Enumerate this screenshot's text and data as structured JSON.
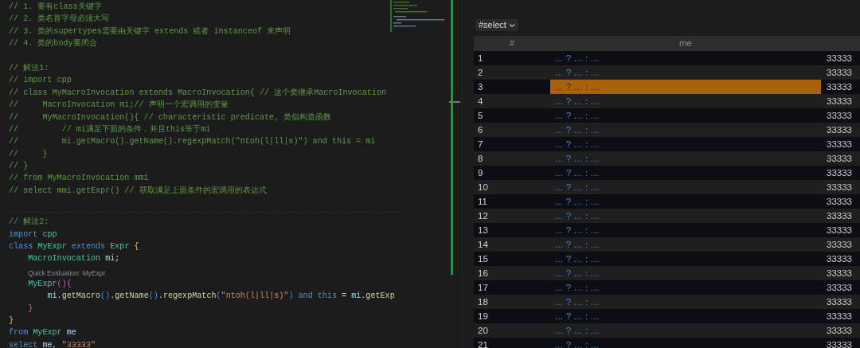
{
  "editor": {
    "lines": [
      {
        "kind": "code",
        "tokens": [
          {
            "text": "// 1. 要有class关键字",
            "kind": "comment"
          }
        ]
      },
      {
        "kind": "code",
        "tokens": [
          {
            "text": "// 2. 类名首字母必须大写",
            "kind": "comment"
          }
        ]
      },
      {
        "kind": "code",
        "tokens": [
          {
            "text": "// 3. 类的supertypes需要由关键字 extends 或者 instanceof 来声明",
            "kind": "comment"
          }
        ]
      },
      {
        "kind": "code",
        "tokens": [
          {
            "text": "// 4. 类的body要闭合",
            "kind": "comment"
          }
        ]
      },
      {
        "kind": "blank"
      },
      {
        "kind": "code",
        "tokens": [
          {
            "text": "// 解法1:",
            "kind": "comment"
          }
        ]
      },
      {
        "kind": "code",
        "tokens": [
          {
            "text": "// import cpp",
            "kind": "comment"
          }
        ]
      },
      {
        "kind": "code",
        "tokens": [
          {
            "text": "// class MyMacroInvocation extends MacroInvocation{ // 这个类继承MacroInvocation",
            "kind": "comment"
          }
        ]
      },
      {
        "kind": "code",
        "tokens": [
          {
            "text": "//     MacroInvocation mi;// 声明一个宏调用的变量",
            "kind": "comment"
          }
        ]
      },
      {
        "kind": "code",
        "tokens": [
          {
            "text": "//     MyMacroInvocation(){ // characteristic predicate, 类似构造函数",
            "kind": "comment"
          }
        ]
      },
      {
        "kind": "code",
        "tokens": [
          {
            "text": "//         // mi满足下面的条件，并且this等于mi",
            "kind": "comment"
          }
        ]
      },
      {
        "kind": "code",
        "tokens": [
          {
            "text": "//         mi.getMacro().getName().regexpMatch(\"ntoh(l|ll|s)\") and this = mi",
            "kind": "comment"
          }
        ]
      },
      {
        "kind": "code",
        "tokens": [
          {
            "text": "//     }",
            "kind": "comment"
          }
        ]
      },
      {
        "kind": "code",
        "tokens": [
          {
            "text": "// }",
            "kind": "comment"
          }
        ]
      },
      {
        "kind": "code",
        "tokens": [
          {
            "text": "// from MyMacroInvocation mmi",
            "kind": "comment"
          }
        ]
      },
      {
        "kind": "code",
        "tokens": [
          {
            "text": "// select mmi.getExpr() // 获取满足上面条件的宏调用的表达式",
            "kind": "comment"
          }
        ]
      },
      {
        "kind": "blank"
      },
      {
        "kind": "code",
        "tokens": [
          {
            "text": "// 解法2:",
            "kind": "comment"
          }
        ]
      },
      {
        "kind": "code",
        "tokens": [
          {
            "text": "import",
            "kind": "keyword"
          },
          {
            "text": " cpp",
            "kind": "type"
          }
        ]
      },
      {
        "kind": "code",
        "tokens": [
          {
            "text": "class",
            "kind": "keyword"
          },
          {
            "text": " MyExpr",
            "kind": "type"
          },
          {
            "text": " extends",
            "kind": "keyword"
          },
          {
            "text": " Expr",
            "kind": "type"
          },
          {
            "text": " {",
            "kind": "brace1"
          }
        ]
      },
      {
        "kind": "code",
        "tokens": [
          {
            "text": "    MacroInvocation",
            "kind": "type"
          },
          {
            "text": " mi",
            "kind": "ident"
          },
          {
            "text": ";",
            "kind": "plain"
          }
        ]
      },
      {
        "kind": "codelens",
        "text": "Quick Evaluation: MyExpr"
      },
      {
        "kind": "code",
        "tokens": [
          {
            "text": "    MyExpr",
            "kind": "type"
          },
          {
            "text": "(){",
            "kind": "brace2"
          }
        ]
      },
      {
        "kind": "code",
        "tokens": [
          {
            "text": "        mi",
            "kind": "ident"
          },
          {
            "text": ".",
            "kind": "plain"
          },
          {
            "text": "getMacro",
            "kind": "func"
          },
          {
            "text": "()",
            "kind": "brace3"
          },
          {
            "text": ".",
            "kind": "plain"
          },
          {
            "text": "getName",
            "kind": "func"
          },
          {
            "text": "()",
            "kind": "brace3"
          },
          {
            "text": ".",
            "kind": "plain"
          },
          {
            "text": "regexpMatch",
            "kind": "func"
          },
          {
            "text": "(",
            "kind": "brace3"
          },
          {
            "text": "\"ntoh(l|ll|s)\"",
            "kind": "string"
          },
          {
            "text": ")",
            "kind": "brace3"
          },
          {
            "text": " and",
            "kind": "keyword"
          },
          {
            "text": " this",
            "kind": "keyword"
          },
          {
            "text": " = ",
            "kind": "plain"
          },
          {
            "text": "mi",
            "kind": "ident"
          },
          {
            "text": ".",
            "kind": "plain"
          },
          {
            "text": "getExp",
            "kind": "func"
          }
        ]
      },
      {
        "kind": "code",
        "tokens": [
          {
            "text": "    }",
            "kind": "brace2"
          }
        ]
      },
      {
        "kind": "code",
        "tokens": [
          {
            "text": "}",
            "kind": "brace1"
          }
        ]
      },
      {
        "kind": "code",
        "tokens": [
          {
            "text": "from",
            "kind": "keyword"
          },
          {
            "text": " MyExpr",
            "kind": "type"
          },
          {
            "text": " me",
            "kind": "ident"
          }
        ]
      },
      {
        "kind": "code",
        "tokens": [
          {
            "text": "select",
            "kind": "keyword"
          },
          {
            "text": " me",
            "kind": "ident"
          },
          {
            "text": ", ",
            "kind": "plain"
          },
          {
            "text": "\"33333\"",
            "kind": "string"
          }
        ]
      }
    ]
  },
  "results": {
    "result_set": "#select",
    "columns": [
      "#",
      "me"
    ],
    "rows": [
      {
        "index": "1",
        "me": "… ? … : …",
        "column_3": "33333",
        "selected": false
      },
      {
        "index": "2",
        "me": "… ? … : …",
        "column_3": "33333",
        "selected": false
      },
      {
        "index": "3",
        "me": "… ? … : …",
        "column_3": "33333",
        "selected": true
      },
      {
        "index": "4",
        "me": "… ? … : …",
        "column_3": "33333",
        "selected": false
      },
      {
        "index": "5",
        "me": "… ? … : …",
        "column_3": "33333",
        "selected": false
      },
      {
        "index": "6",
        "me": "… ? … : …",
        "column_3": "33333",
        "selected": false
      },
      {
        "index": "7",
        "me": "… ? … : …",
        "column_3": "33333",
        "selected": false
      },
      {
        "index": "8",
        "me": "… ? … : …",
        "column_3": "33333",
        "selected": false
      },
      {
        "index": "9",
        "me": "… ? … : …",
        "column_3": "33333",
        "selected": false
      },
      {
        "index": "10",
        "me": "… ? … : …",
        "column_3": "33333",
        "selected": false
      },
      {
        "index": "11",
        "me": "… ? … : …",
        "column_3": "33333",
        "selected": false
      },
      {
        "index": "12",
        "me": "… ? … : …",
        "column_3": "33333",
        "selected": false
      },
      {
        "index": "13",
        "me": "… ? … : …",
        "column_3": "33333",
        "selected": false
      },
      {
        "index": "14",
        "me": "… ? … : …",
        "column_3": "33333",
        "selected": false
      },
      {
        "index": "15",
        "me": "… ? … : …",
        "column_3": "33333",
        "selected": false
      },
      {
        "index": "16",
        "me": "… ? … : …",
        "column_3": "33333",
        "selected": false
      },
      {
        "index": "17",
        "me": "… ? … : …",
        "column_3": "33333",
        "selected": false
      },
      {
        "index": "18",
        "me": "… ? … : …",
        "column_3": "33333",
        "selected": false
      },
      {
        "index": "19",
        "me": "… ? … : …",
        "column_3": "33333",
        "selected": false
      },
      {
        "index": "20",
        "me": "… ? … : …",
        "column_3": "33333",
        "selected": false
      },
      {
        "index": "21",
        "me": "… ? … : …",
        "column_3": "33333",
        "selected": false
      }
    ]
  }
}
